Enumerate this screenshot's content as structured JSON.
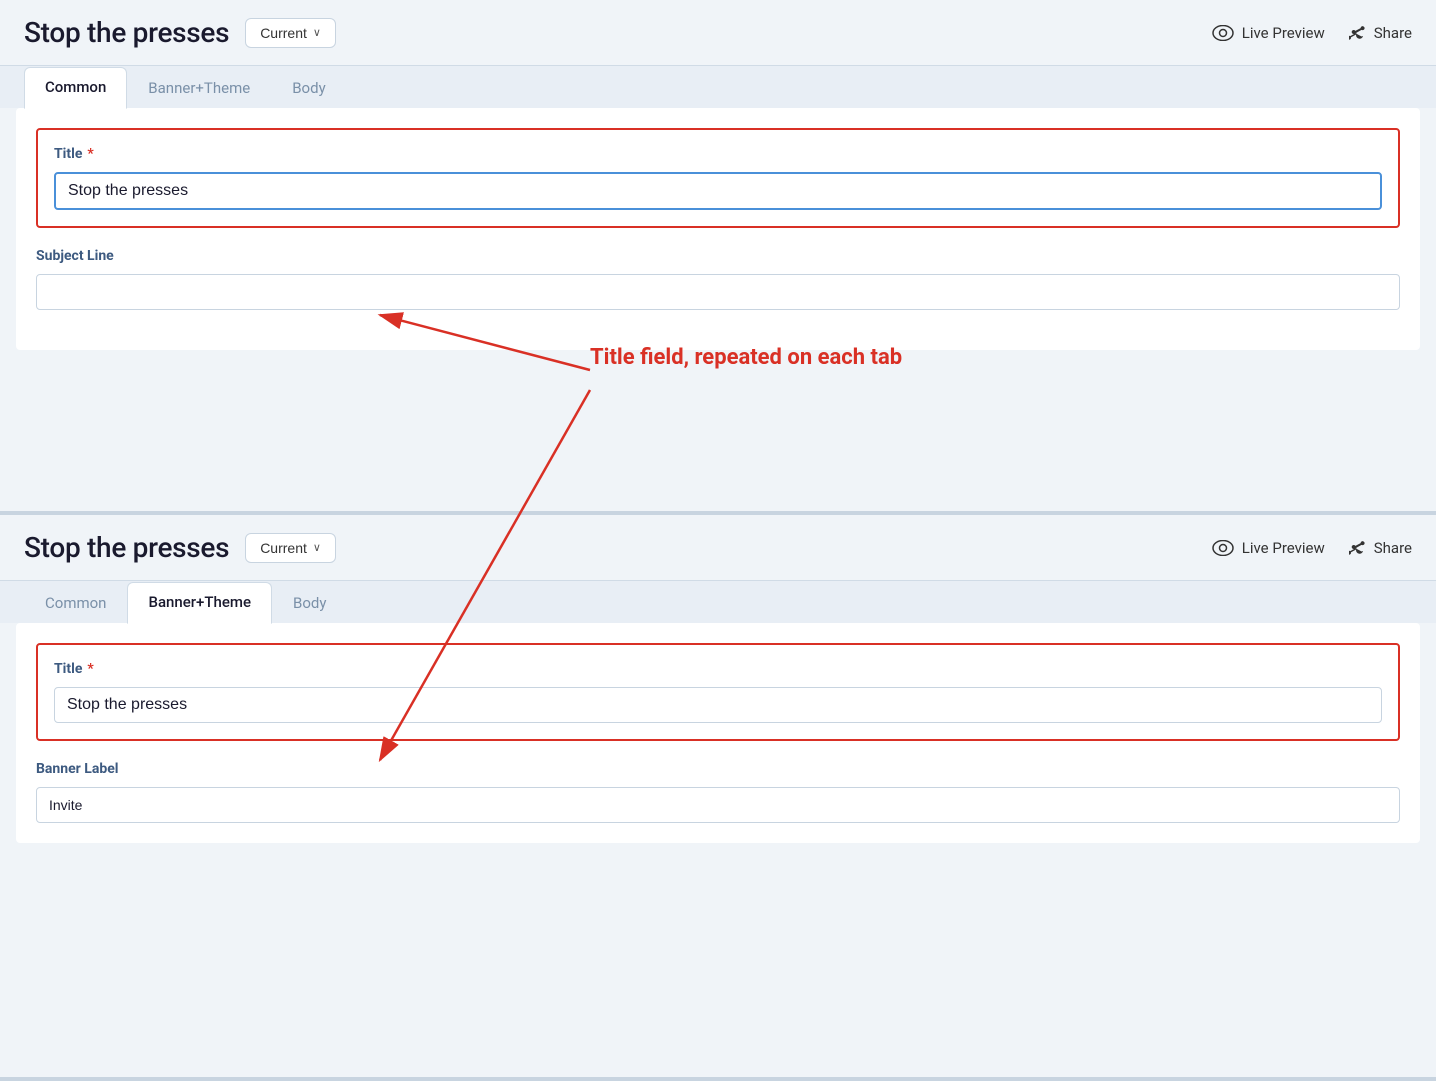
{
  "panel1": {
    "title": "Stop the presses",
    "version_label": "Current",
    "chevron": "∨",
    "live_preview_label": "Live Preview",
    "share_label": "Share",
    "tabs": [
      {
        "id": "common",
        "label": "Common",
        "active": true
      },
      {
        "id": "banner-theme",
        "label": "Banner+Theme",
        "active": false
      },
      {
        "id": "body",
        "label": "Body",
        "active": false
      }
    ],
    "title_field": {
      "label": "Title",
      "required": "*",
      "value": "Stop the presses"
    },
    "subject_field": {
      "label": "Subject Line",
      "value": ""
    }
  },
  "panel2": {
    "title": "Stop the presses",
    "version_label": "Current",
    "chevron": "∨",
    "live_preview_label": "Live Preview",
    "share_label": "Share",
    "tabs": [
      {
        "id": "common",
        "label": "Common",
        "active": false
      },
      {
        "id": "banner-theme",
        "label": "Banner+Theme",
        "active": true
      },
      {
        "id": "body",
        "label": "Body",
        "active": false
      }
    ],
    "title_field": {
      "label": "Title",
      "required": "*",
      "value": "Stop the presses"
    },
    "banner_field": {
      "label": "Banner Label",
      "value": "Invite"
    }
  },
  "annotation": {
    "text": "Title field, repeated on each tab"
  }
}
